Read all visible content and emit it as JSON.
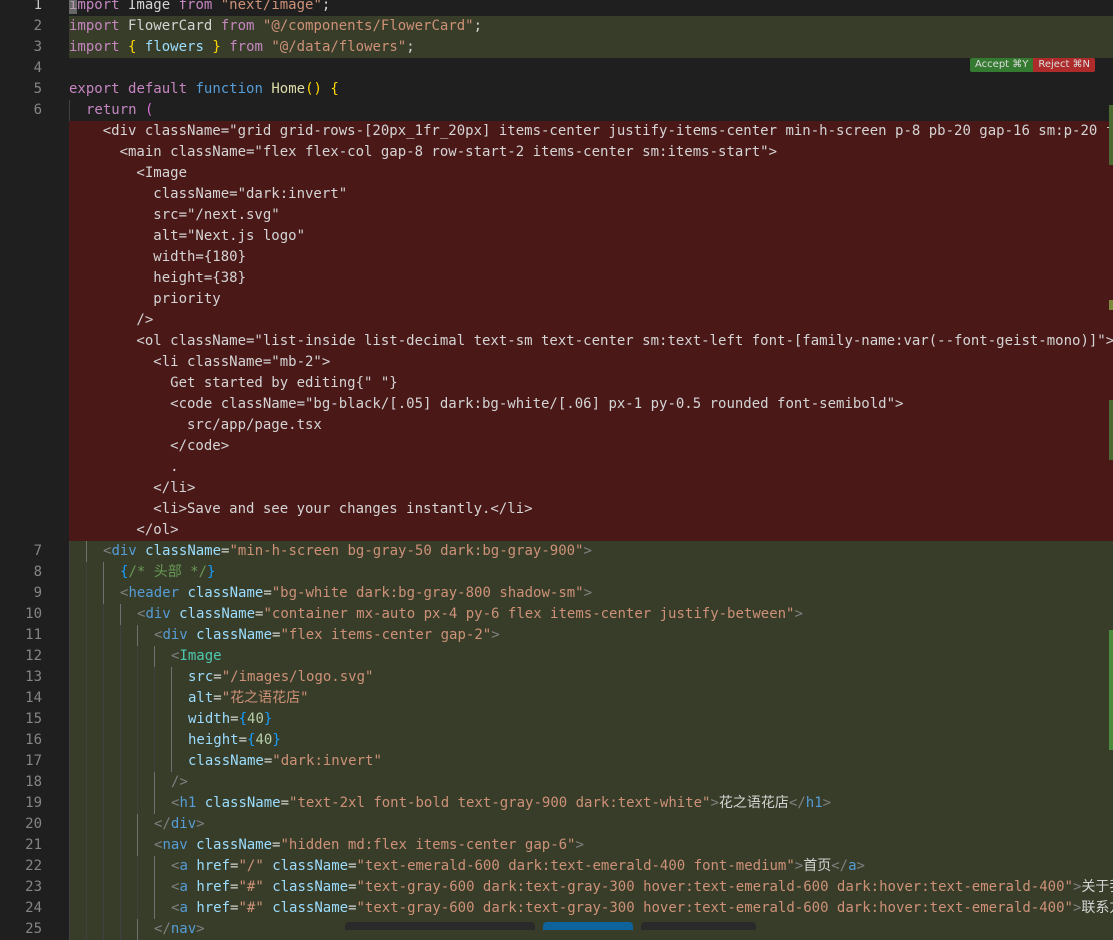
{
  "editor": {
    "lines": [
      {
        "num": "1",
        "kind": "normal",
        "active": true,
        "tokens": [
          [
            "kw",
            "import"
          ],
          [
            "p",
            " Image "
          ],
          [
            "kw",
            "from"
          ],
          [
            "p",
            " "
          ],
          [
            "s",
            "\"next/image\""
          ],
          [
            "p",
            ";"
          ]
        ]
      },
      {
        "num": "2",
        "kind": "added",
        "tokens": [
          [
            "kw",
            "import"
          ],
          [
            "p",
            " FlowerCard "
          ],
          [
            "kw",
            "from"
          ],
          [
            "p",
            " "
          ],
          [
            "s",
            "\"@/components/FlowerCard\""
          ],
          [
            "p",
            ";"
          ]
        ]
      },
      {
        "num": "3",
        "kind": "added",
        "tokens": [
          [
            "kw",
            "import"
          ],
          [
            "p",
            " "
          ],
          [
            "b1",
            "{"
          ],
          [
            "p",
            " "
          ],
          [
            "v",
            "flowers"
          ],
          [
            "p",
            " "
          ],
          [
            "b1",
            "}"
          ],
          [
            "p",
            " "
          ],
          [
            "kw",
            "from"
          ],
          [
            "p",
            " "
          ],
          [
            "s",
            "\"@/data/flowers\""
          ],
          [
            "p",
            ";"
          ]
        ]
      },
      {
        "num": "4",
        "kind": "normal",
        "tokens": []
      },
      {
        "num": "5",
        "kind": "normal",
        "tokens": [
          [
            "kw",
            "export"
          ],
          [
            "p",
            " "
          ],
          [
            "kw",
            "default"
          ],
          [
            "p",
            " "
          ],
          [
            "k",
            "function"
          ],
          [
            "p",
            " "
          ],
          [
            "f",
            "Home"
          ],
          [
            "b1",
            "()"
          ],
          [
            "p",
            " "
          ],
          [
            "b1",
            "{"
          ]
        ]
      },
      {
        "num": "6",
        "kind": "normal",
        "guides": 1,
        "tokens": [
          [
            "kw",
            "return"
          ],
          [
            "p",
            " "
          ],
          [
            "b2",
            "("
          ]
        ]
      },
      {
        "num": "",
        "kind": "deleted",
        "tokens": [
          [
            "p",
            "    <div className=\"grid grid-rows-[20px_1fr_20px] items-center justify-items-center min-h-screen p-8 pb-20 gap-16 sm:p-20 font"
          ]
        ]
      },
      {
        "num": "",
        "kind": "deleted",
        "tokens": [
          [
            "p",
            "      <main className=\"flex flex-col gap-8 row-start-2 items-center sm:items-start\">"
          ]
        ]
      },
      {
        "num": "",
        "kind": "deleted",
        "tokens": [
          [
            "p",
            "        <Image"
          ]
        ]
      },
      {
        "num": "",
        "kind": "deleted",
        "tokens": [
          [
            "p",
            "          className=\"dark:invert\""
          ]
        ]
      },
      {
        "num": "",
        "kind": "deleted",
        "tokens": [
          [
            "p",
            "          src=\"/next.svg\""
          ]
        ]
      },
      {
        "num": "",
        "kind": "deleted",
        "tokens": [
          [
            "p",
            "          alt=\"Next.js logo\""
          ]
        ]
      },
      {
        "num": "",
        "kind": "deleted",
        "tokens": [
          [
            "p",
            "          width={180}"
          ]
        ]
      },
      {
        "num": "",
        "kind": "deleted",
        "tokens": [
          [
            "p",
            "          height={38}"
          ]
        ]
      },
      {
        "num": "",
        "kind": "deleted",
        "tokens": [
          [
            "p",
            "          priority"
          ]
        ]
      },
      {
        "num": "",
        "kind": "deleted",
        "tokens": [
          [
            "p",
            "        />"
          ]
        ]
      },
      {
        "num": "",
        "kind": "deleted",
        "tokens": [
          [
            "p",
            "        <ol className=\"list-inside list-decimal text-sm text-center sm:text-left font-[family-name:var(--font-geist-mono)]\">"
          ]
        ]
      },
      {
        "num": "",
        "kind": "deleted",
        "tokens": [
          [
            "p",
            "          <li className=\"mb-2\">"
          ]
        ]
      },
      {
        "num": "",
        "kind": "deleted",
        "tokens": [
          [
            "p",
            "            Get started by editing{\" \"}"
          ]
        ]
      },
      {
        "num": "",
        "kind": "deleted",
        "tokens": [
          [
            "p",
            "            <code className=\"bg-black/[.05] dark:bg-white/[.06] px-1 py-0.5 rounded font-semibold\">"
          ]
        ]
      },
      {
        "num": "",
        "kind": "deleted",
        "tokens": [
          [
            "p",
            "              src/app/page.tsx"
          ]
        ]
      },
      {
        "num": "",
        "kind": "deleted",
        "tokens": [
          [
            "p",
            "            </code>"
          ]
        ]
      },
      {
        "num": "",
        "kind": "deleted",
        "tokens": [
          [
            "p",
            "            ."
          ]
        ]
      },
      {
        "num": "",
        "kind": "deleted",
        "tokens": [
          [
            "p",
            "          </li>"
          ]
        ]
      },
      {
        "num": "",
        "kind": "deleted",
        "tokens": [
          [
            "p",
            "          <li>Save and see your changes instantly.</li>"
          ]
        ]
      },
      {
        "num": "",
        "kind": "deleted",
        "tokens": [
          [
            "p",
            "        </ol>"
          ]
        ]
      },
      {
        "num": "7",
        "kind": "added",
        "guides": 2,
        "tokens": [
          [
            "punc",
            "<"
          ],
          [
            "t",
            "div"
          ],
          [
            "p",
            " "
          ],
          [
            "a",
            "className"
          ],
          [
            "p",
            "="
          ],
          [
            "s",
            "\"min-h-screen bg-gray-50 dark:bg-gray-900\""
          ],
          [
            "punc",
            ">"
          ]
        ]
      },
      {
        "num": "8",
        "kind": "added",
        "guides": 3,
        "tokens": [
          [
            "b3",
            "{"
          ],
          [
            "c",
            "/* 头部 */"
          ],
          [
            "b3",
            "}"
          ]
        ]
      },
      {
        "num": "9",
        "kind": "added",
        "guides": 3,
        "tokens": [
          [
            "punc",
            "<"
          ],
          [
            "t",
            "header"
          ],
          [
            "p",
            " "
          ],
          [
            "a",
            "className"
          ],
          [
            "p",
            "="
          ],
          [
            "s",
            "\"bg-white dark:bg-gray-800 shadow-sm\""
          ],
          [
            "punc",
            ">"
          ]
        ]
      },
      {
        "num": "10",
        "kind": "added",
        "guides": 4,
        "tokens": [
          [
            "punc",
            "<"
          ],
          [
            "t",
            "div"
          ],
          [
            "p",
            " "
          ],
          [
            "a",
            "className"
          ],
          [
            "p",
            "="
          ],
          [
            "s",
            "\"container mx-auto px-4 py-6 flex items-center justify-between\""
          ],
          [
            "punc",
            ">"
          ]
        ]
      },
      {
        "num": "11",
        "kind": "added",
        "guides": 5,
        "tokens": [
          [
            "punc",
            "<"
          ],
          [
            "t",
            "div"
          ],
          [
            "p",
            " "
          ],
          [
            "a",
            "className"
          ],
          [
            "p",
            "="
          ],
          [
            "s",
            "\"flex items-center gap-2\""
          ],
          [
            "punc",
            ">"
          ]
        ]
      },
      {
        "num": "12",
        "kind": "added",
        "guides": 6,
        "tokens": [
          [
            "punc",
            "<"
          ],
          [
            "tg",
            "Image"
          ]
        ]
      },
      {
        "num": "13",
        "kind": "added",
        "guides": 7,
        "tokens": [
          [
            "a",
            "src"
          ],
          [
            "p",
            "="
          ],
          [
            "s",
            "\"/images/logo.svg\""
          ]
        ]
      },
      {
        "num": "14",
        "kind": "added",
        "guides": 7,
        "tokens": [
          [
            "a",
            "alt"
          ],
          [
            "p",
            "="
          ],
          [
            "s",
            "\"花之语花店\""
          ]
        ]
      },
      {
        "num": "15",
        "kind": "added",
        "guides": 7,
        "tokens": [
          [
            "a",
            "width"
          ],
          [
            "p",
            "="
          ],
          [
            "b3",
            "{"
          ],
          [
            "n",
            "40"
          ],
          [
            "b3",
            "}"
          ]
        ]
      },
      {
        "num": "16",
        "kind": "added",
        "guides": 7,
        "tokens": [
          [
            "a",
            "height"
          ],
          [
            "p",
            "="
          ],
          [
            "b3",
            "{"
          ],
          [
            "n",
            "40"
          ],
          [
            "b3",
            "}"
          ]
        ]
      },
      {
        "num": "17",
        "kind": "added",
        "guides": 7,
        "tokens": [
          [
            "a",
            "className"
          ],
          [
            "p",
            "="
          ],
          [
            "s",
            "\"dark:invert\""
          ]
        ]
      },
      {
        "num": "18",
        "kind": "added",
        "guides": 6,
        "tokens": [
          [
            "punc",
            "/>"
          ]
        ]
      },
      {
        "num": "19",
        "kind": "added",
        "guides": 6,
        "tokens": [
          [
            "punc",
            "<"
          ],
          [
            "t",
            "h1"
          ],
          [
            "p",
            " "
          ],
          [
            "a",
            "className"
          ],
          [
            "p",
            "="
          ],
          [
            "s",
            "\"text-2xl font-bold text-gray-900 dark:text-white\""
          ],
          [
            "punc",
            ">"
          ],
          [
            "p",
            "花之语花店"
          ],
          [
            "punc",
            "</"
          ],
          [
            "t",
            "h1"
          ],
          [
            "punc",
            ">"
          ]
        ]
      },
      {
        "num": "20",
        "kind": "added",
        "guides": 5,
        "tokens": [
          [
            "punc",
            "</"
          ],
          [
            "t",
            "div"
          ],
          [
            "punc",
            ">"
          ]
        ]
      },
      {
        "num": "21",
        "kind": "added",
        "guides": 5,
        "tokens": [
          [
            "punc",
            "<"
          ],
          [
            "t",
            "nav"
          ],
          [
            "p",
            " "
          ],
          [
            "a",
            "className"
          ],
          [
            "p",
            "="
          ],
          [
            "s",
            "\"hidden md:flex items-center gap-6\""
          ],
          [
            "punc",
            ">"
          ]
        ]
      },
      {
        "num": "22",
        "kind": "added",
        "guides": 6,
        "tokens": [
          [
            "punc",
            "<"
          ],
          [
            "t",
            "a"
          ],
          [
            "p",
            " "
          ],
          [
            "a",
            "href"
          ],
          [
            "p",
            "="
          ],
          [
            "s",
            "\"/\""
          ],
          [
            "p",
            " "
          ],
          [
            "a",
            "className"
          ],
          [
            "p",
            "="
          ],
          [
            "s",
            "\"text-emerald-600 dark:text-emerald-400 font-medium\""
          ],
          [
            "punc",
            ">"
          ],
          [
            "p",
            "首页"
          ],
          [
            "punc",
            "</"
          ],
          [
            "t",
            "a"
          ],
          [
            "punc",
            ">"
          ]
        ]
      },
      {
        "num": "23",
        "kind": "added",
        "guides": 6,
        "tokens": [
          [
            "punc",
            "<"
          ],
          [
            "t",
            "a"
          ],
          [
            "p",
            " "
          ],
          [
            "a",
            "href"
          ],
          [
            "p",
            "="
          ],
          [
            "s",
            "\"#\""
          ],
          [
            "p",
            " "
          ],
          [
            "a",
            "className"
          ],
          [
            "p",
            "="
          ],
          [
            "s",
            "\"text-gray-600 dark:text-gray-300 hover:text-emerald-600 dark:hover:text-emerald-400\""
          ],
          [
            "punc",
            ">"
          ],
          [
            "p",
            "关于我们"
          ]
        ]
      },
      {
        "num": "24",
        "kind": "added",
        "guides": 6,
        "tokens": [
          [
            "punc",
            "<"
          ],
          [
            "t",
            "a"
          ],
          [
            "p",
            " "
          ],
          [
            "a",
            "href"
          ],
          [
            "p",
            "="
          ],
          [
            "s",
            "\"#\""
          ],
          [
            "p",
            " "
          ],
          [
            "a",
            "className"
          ],
          [
            "p",
            "="
          ],
          [
            "s",
            "\"text-gray-600 dark:text-gray-300 hover:text-emerald-600 dark:hover:text-emerald-400\""
          ],
          [
            "punc",
            ">"
          ],
          [
            "p",
            "联系方式"
          ]
        ]
      },
      {
        "num": "25",
        "kind": "added",
        "guides": 5,
        "tokens": [
          [
            "punc",
            "</"
          ],
          [
            "t",
            "nav"
          ],
          [
            "punc",
            ">"
          ]
        ]
      }
    ]
  },
  "diff_actions": {
    "accept_label": "Accept ⌘Y",
    "reject_label": "Reject ⌘N"
  },
  "colors": {
    "added_bg": "#373d29",
    "deleted_bg": "#4b1818",
    "accept": "#388a34",
    "reject": "#c72e2e"
  }
}
